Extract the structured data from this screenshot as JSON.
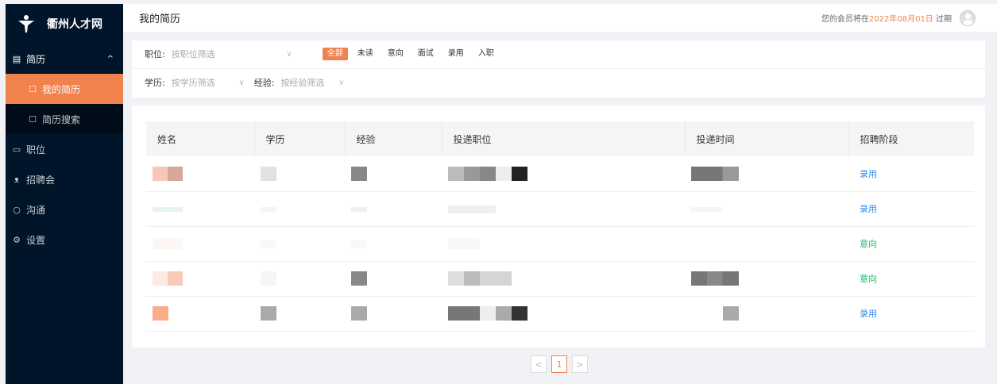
{
  "app": {
    "name": "衢州人才网"
  },
  "sidebar": {
    "items": [
      {
        "label": "简历",
        "icon": "doc-icon",
        "caret": "^"
      },
      {
        "label": "我的简历",
        "icon": "resume-icon",
        "active": true
      },
      {
        "label": "简历搜索",
        "icon": "resume-search-icon"
      },
      {
        "label": "职位",
        "icon": "monitor-icon"
      },
      {
        "label": "招聘会",
        "icon": "people-icon"
      },
      {
        "label": "沟通",
        "icon": "chat-icon"
      },
      {
        "label": "设置",
        "icon": "gear-icon"
      }
    ]
  },
  "header": {
    "title": "我的简历",
    "member_prefix": "您的会员将在",
    "member_date": "2022年08月01日",
    "member_suffix": " 过期"
  },
  "filters": {
    "position_label": "职位:",
    "position_placeholder": "按职位筛选",
    "status_chips": [
      "全部",
      "未读",
      "意向",
      "面试",
      "录用",
      "入职"
    ],
    "education_label": "学历:",
    "education_placeholder": "按学历筛选",
    "experience_label": "经验:",
    "experience_placeholder": "按经验筛选"
  },
  "table": {
    "columns": [
      "姓名",
      "学历",
      "经验",
      "投递职位",
      "投递时间",
      "招聘阶段"
    ],
    "rows": [
      {
        "stage": "录用"
      },
      {
        "stage": "录用"
      },
      {
        "stage": "意向"
      },
      {
        "stage": "意向"
      },
      {
        "stage": "录用"
      }
    ]
  },
  "pagination": {
    "prev": "<",
    "current": "1",
    "next": ">"
  },
  "colors": {
    "accent": "#f2824d",
    "sidebar": "#001529",
    "hired": "#2d8cf0",
    "intent": "#19be6b"
  }
}
